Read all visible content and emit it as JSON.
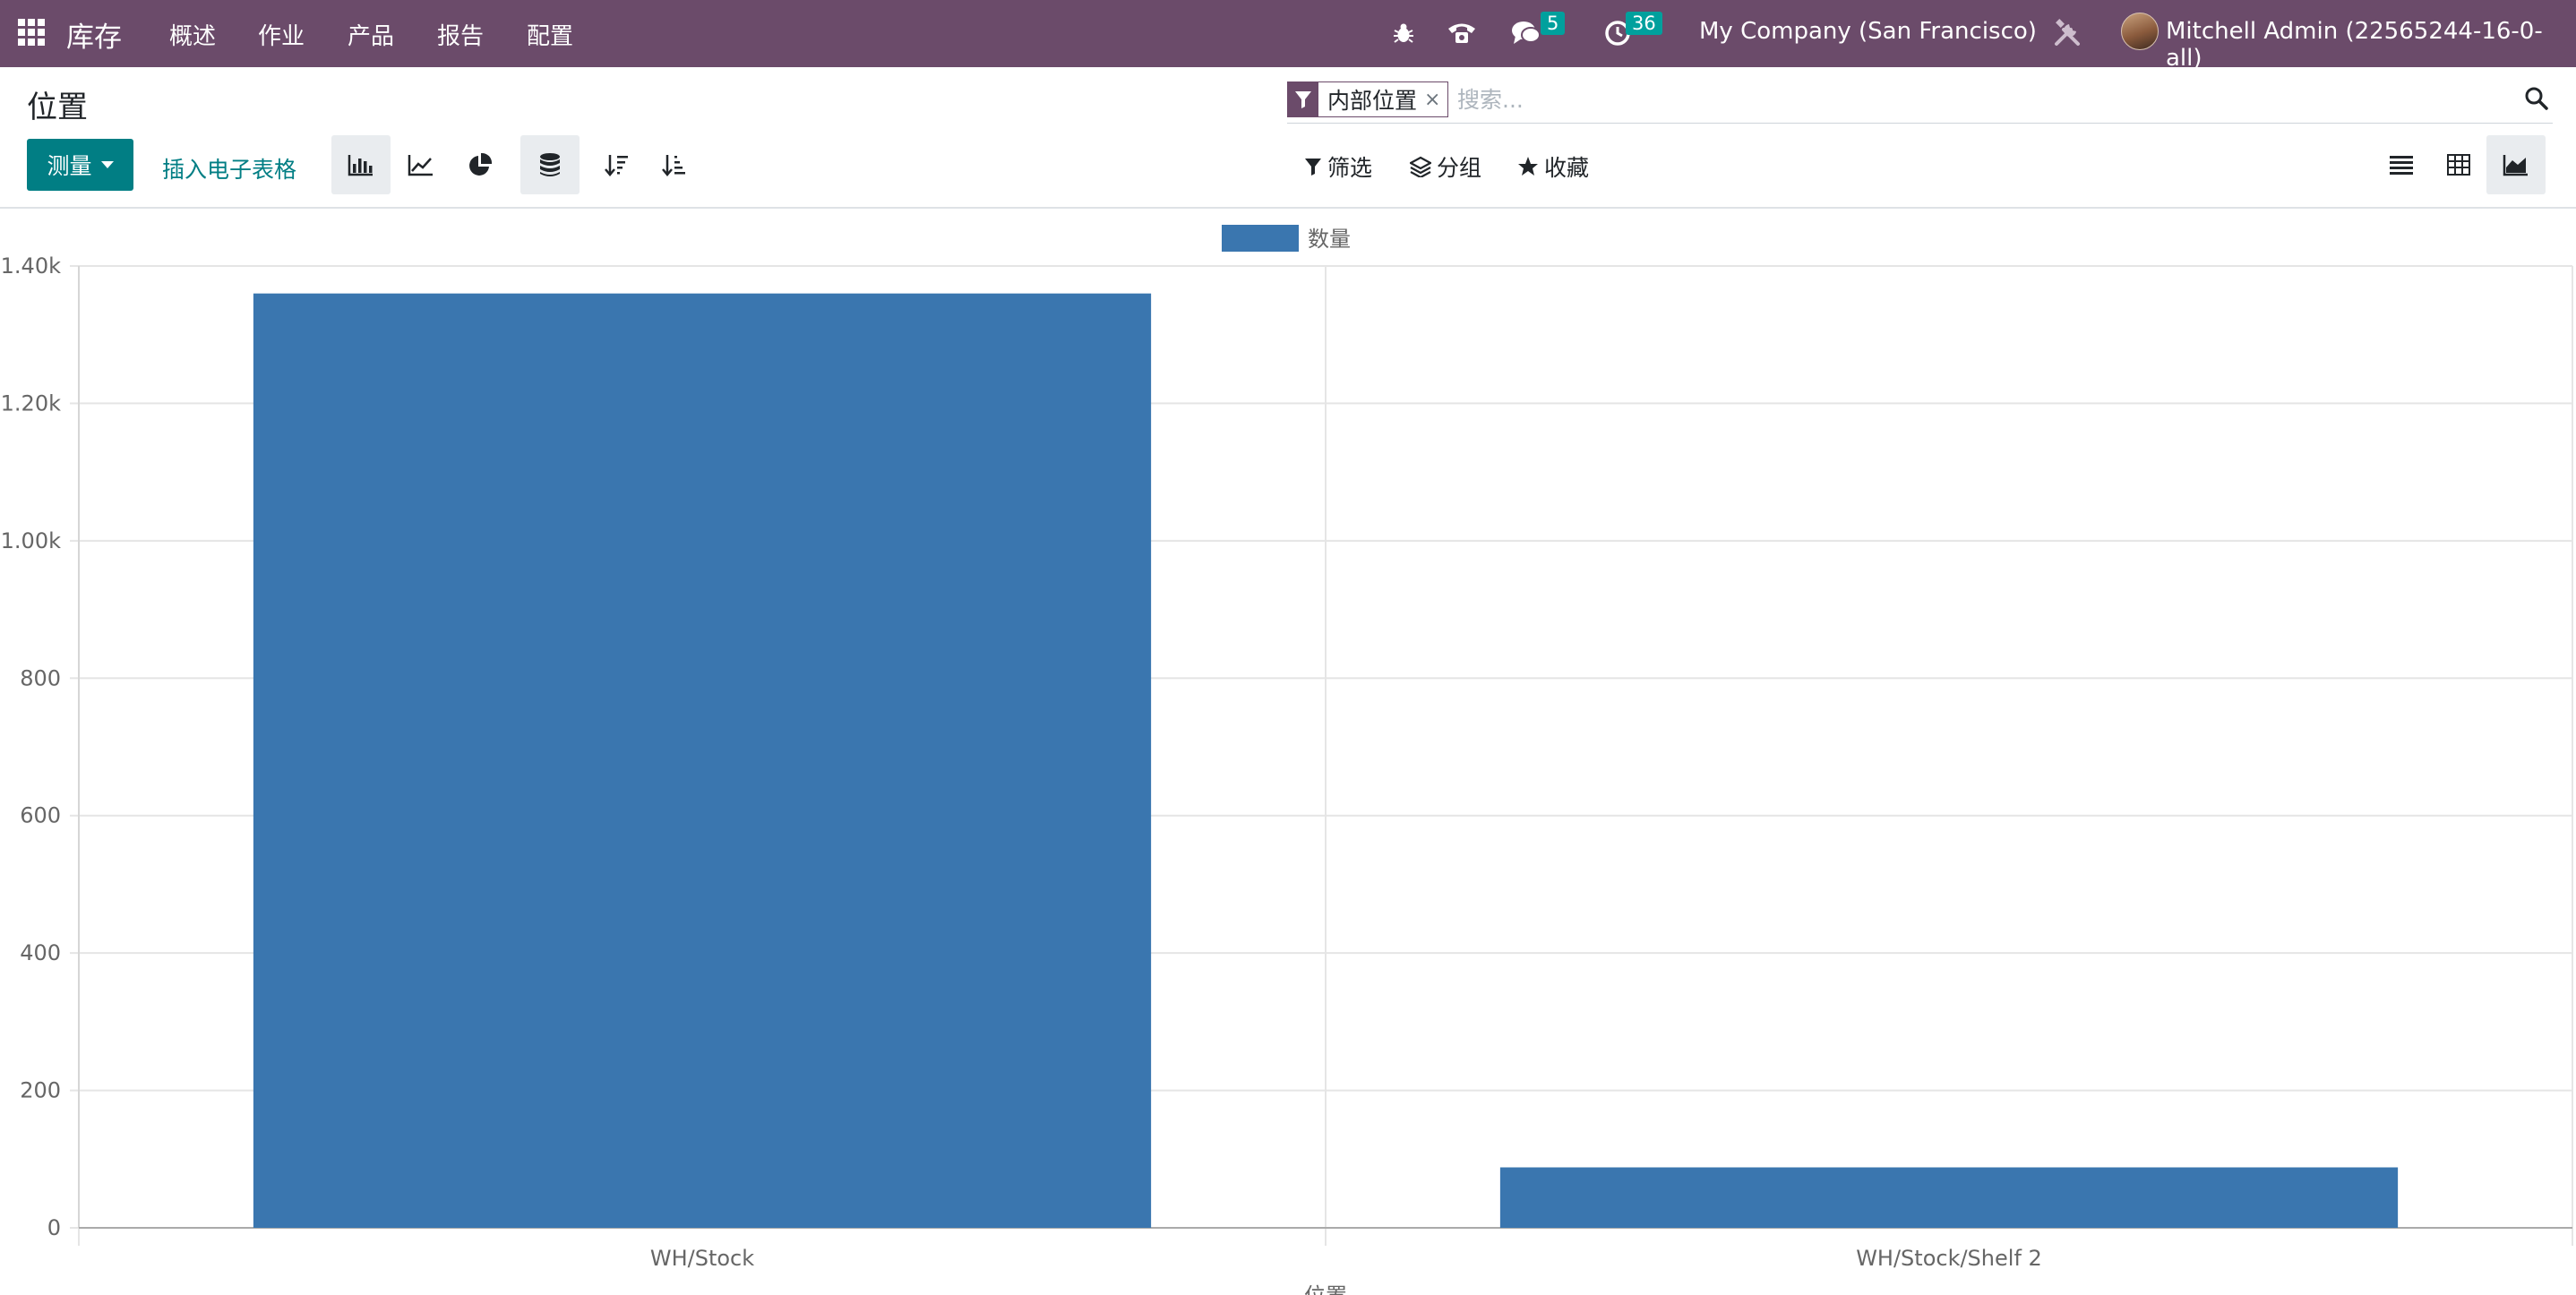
{
  "navbar": {
    "brand": "库存",
    "menu": [
      {
        "label": "概述"
      },
      {
        "label": "作业"
      },
      {
        "label": "产品"
      },
      {
        "label": "报告"
      },
      {
        "label": "配置"
      }
    ],
    "messages_count": "5",
    "activities_count": "36",
    "company": "My Company (San Francisco)",
    "user": "Mitchell Admin (22565244-16-0-all)"
  },
  "control_panel": {
    "title": "位置",
    "search": {
      "facet_value": "内部位置",
      "facet_remove": "×",
      "placeholder": "搜索..."
    },
    "measure_label": "测量",
    "insert_spreadsheet_label": "插入电子表格",
    "filters_label": "筛选",
    "groupby_label": "分组",
    "favorites_label": "收藏"
  },
  "colors": {
    "navbar": "#6b4b6a",
    "primary": "#017e84",
    "bar": "#3a76af",
    "badge": "#00a09d"
  },
  "chart_data": {
    "type": "bar",
    "categories": [
      "WH/Stock",
      "WH/Stock/Shelf 2"
    ],
    "series": [
      {
        "name": "数量",
        "values": [
          1360,
          88
        ]
      }
    ],
    "ylim": [
      0,
      1400
    ],
    "yticks": [
      0,
      200,
      400,
      600,
      800,
      1000,
      1200,
      1400
    ],
    "ytick_labels": [
      "0",
      "200",
      "400",
      "600",
      "800",
      "1.00k",
      "1.20k",
      "1.40k"
    ],
    "legend_position": "top-center",
    "grid": true,
    "xlabel": "位置"
  }
}
